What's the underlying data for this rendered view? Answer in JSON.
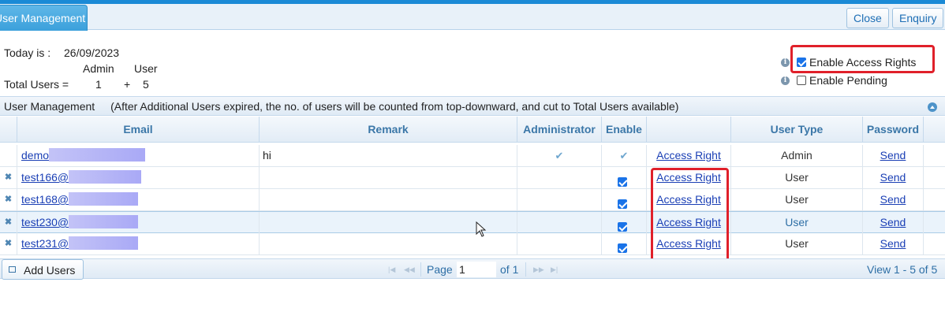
{
  "tabs": {
    "active": "User Management"
  },
  "toolbar": {
    "close_label": "Close",
    "enquiry_label": "Enquiry"
  },
  "summary": {
    "today_label": "Today is :",
    "today_value": "26/09/2023",
    "admin_header": "Admin",
    "user_header": "User",
    "total_label": "Total Users =",
    "admin_count": "1",
    "plus": "+",
    "user_count": "5"
  },
  "options": {
    "enable_access_rights": {
      "label": "Enable Access Rights",
      "checked": true
    },
    "enable_pending": {
      "label": "Enable Pending",
      "checked": false
    }
  },
  "grid": {
    "caption_title": "User Management",
    "caption_note": "(After Additional Users expired, the no. of users will be counted from top-downward, and cut to Total Users available)",
    "columns": [
      "Email",
      "Remark",
      "Administrator",
      "Enable",
      "",
      "User Type",
      "Password"
    ],
    "rows": [
      {
        "email": "demo",
        "remark": "hi",
        "admin": true,
        "enabled": true,
        "access": "Access Right",
        "user_type": "Admin",
        "password": "Send",
        "deletable": false
      },
      {
        "email": "test166@",
        "remark": "",
        "admin": false,
        "enabled": true,
        "access": "Access Right",
        "user_type": "User",
        "password": "Send",
        "deletable": true
      },
      {
        "email": "test168@",
        "remark": "",
        "admin": false,
        "enabled": true,
        "access": "Access Right",
        "user_type": "User",
        "password": "Send",
        "deletable": true
      },
      {
        "email": "test230@",
        "remark": "",
        "admin": false,
        "enabled": true,
        "access": "Access Right",
        "user_type": "User",
        "password": "Send",
        "deletable": true
      },
      {
        "email": "test231@",
        "remark": "",
        "admin": false,
        "enabled": true,
        "access": "Access Right",
        "user_type": "User",
        "password": "Send",
        "deletable": true
      }
    ]
  },
  "footer": {
    "add_users_label": "Add Users",
    "page_label": "Page",
    "page_value": "1",
    "of_label": "of 1",
    "view_label": "View 1 - 5 of 5"
  },
  "colors": {
    "accent": "#1a8ad6",
    "link": "#1a3fb5",
    "highlight": "#e0202a",
    "header_text": "#3b77a8"
  }
}
